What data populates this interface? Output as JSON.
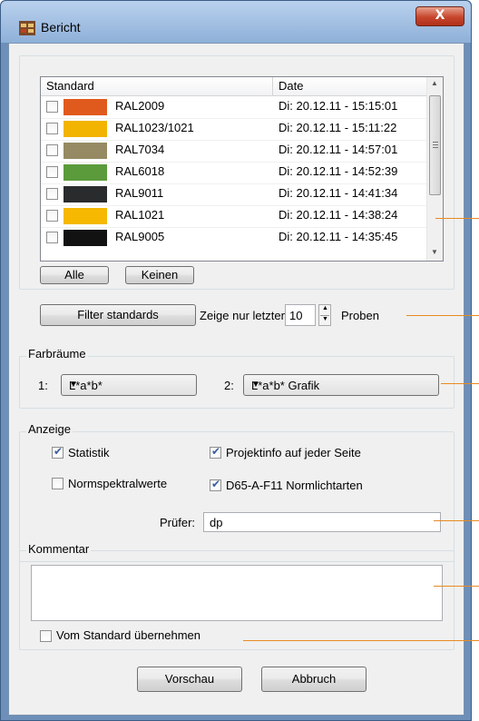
{
  "window": {
    "title": "Bericht",
    "close_glyph": "X",
    "title_icon": "report-icon"
  },
  "list": {
    "columns": [
      "Standard",
      "Date"
    ],
    "rows": [
      {
        "name": "RAL2009",
        "date": "Di: 20.12.11 - 15:15:01",
        "color": "#e05a1e",
        "checked": false
      },
      {
        "name": "RAL1023/1021",
        "date": "Di: 20.12.11 - 15:11:22",
        "color": "#f2b400",
        "checked": false
      },
      {
        "name": "RAL7034",
        "date": "Di: 20.12.11 - 14:57:01",
        "color": "#958a63",
        "checked": false
      },
      {
        "name": "RAL6018",
        "date": "Di: 20.12.11 - 14:52:39",
        "color": "#5b9b3c",
        "checked": false
      },
      {
        "name": "RAL9011",
        "date": "Di: 20.12.11 - 14:41:34",
        "color": "#2a2b2d",
        "checked": false
      },
      {
        "name": "RAL1021",
        "date": "Di: 20.12.11 - 14:38:24",
        "color": "#f6b800",
        "checked": false
      },
      {
        "name": "RAL9005",
        "date": "Di: 20.12.11 - 14:35:45",
        "color": "#121212",
        "checked": false
      }
    ]
  },
  "buttons": {
    "all": "Alle",
    "none": "Keinen",
    "filter": "Filter standards",
    "preview": "Vorschau",
    "cancel": "Abbruch"
  },
  "filter": {
    "prefix": "Zeige nur letzten",
    "count": "10",
    "suffix": "Proben"
  },
  "color_spaces": {
    "title": "Farbräume",
    "label1": "1:",
    "value1": "L*a*b*",
    "label2": "2:",
    "value2": "L*a*b* Grafik"
  },
  "display": {
    "title": "Anzeige",
    "statistik": {
      "label": "Statistik",
      "checked": true
    },
    "normspektral": {
      "label": "Normspektralwerte",
      "checked": false
    },
    "projektinfo": {
      "label": "Projektinfo auf jeder Seite",
      "checked": true
    },
    "d65": {
      "label": "D65-A-F11 Normlichtarten",
      "checked": true
    },
    "pruefer_label": "Prüfer:",
    "pruefer_value": "dp"
  },
  "comment": {
    "title": "Kommentar",
    "value": ""
  },
  "vom_standard": {
    "label": "Vom Standard übernehmen",
    "checked": false
  },
  "colors": {
    "accent_leader": "#e98a22",
    "window_frame": "#6d8fb8"
  }
}
